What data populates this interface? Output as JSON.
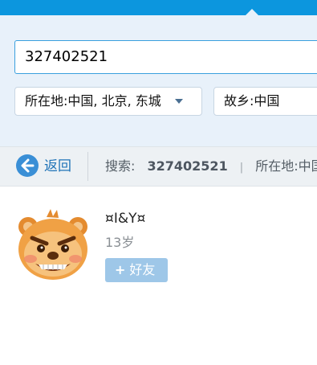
{
  "search": {
    "query_value": "327402521",
    "location_select": "所在地:中国, 北京, 东城",
    "hometown_select": "故乡:中国"
  },
  "toolbar": {
    "back_label": "返回",
    "search_label": "搜索:",
    "search_query": "327402521",
    "separator": "|",
    "location_filter": "所在地:中国"
  },
  "result": {
    "nickname": "¤I&Y¤",
    "age": "13岁",
    "add_friend_icon": "+",
    "add_friend_label": "好友"
  },
  "colors": {
    "accent": "#0c96de",
    "panel": "#e8f1fa",
    "link": "#1f73b7",
    "button": "#9ec7e8"
  },
  "icons": {
    "back": "arrow-left-circle-icon",
    "dropdown": "caret-down-icon",
    "avatar": "bear-cartoon-avatar"
  }
}
